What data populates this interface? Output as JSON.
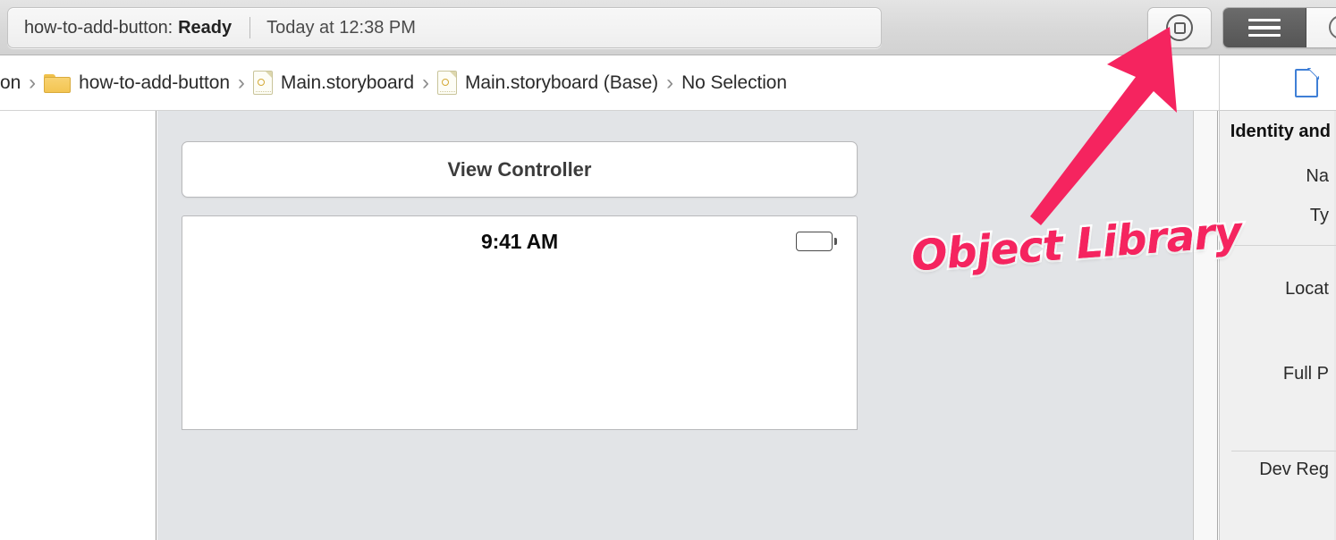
{
  "toolbar": {
    "status": {
      "project": "how-to-add-button:",
      "state": "Ready",
      "time": "Today at 12:38 PM"
    },
    "library_button_icon": "library-circle-square-icon",
    "editor_segments": [
      {
        "name": "standard-editor",
        "icon": "standard-editor-lines-icon",
        "selected": true
      },
      {
        "name": "assistant-editor",
        "icon": "assistant-editor-circles-icon",
        "selected": false
      }
    ]
  },
  "jumpbar": {
    "crumbs": [
      {
        "label": "on",
        "icon": ""
      },
      {
        "label": "how-to-add-button",
        "icon": "folder-icon"
      },
      {
        "label": "Main.storyboard",
        "icon": "storyboard-file-icon"
      },
      {
        "label": "Main.storyboard (Base)",
        "icon": "storyboard-file-icon"
      },
      {
        "label": "No Selection",
        "icon": ""
      }
    ],
    "separator": "›"
  },
  "canvas": {
    "scene_title": "View Controller",
    "device": {
      "status_time": "9:41 AM",
      "battery_icon": "battery-full-icon"
    },
    "background_color": "#e2e4e7"
  },
  "inspector": {
    "tab_icon": "file-inspector-icon",
    "header": "Identity and",
    "labels": [
      "Na",
      "Ty",
      "Locat",
      "Full P",
      "Dev Reg"
    ]
  },
  "annotation": {
    "text": "Object Library",
    "color": "#f5245f",
    "arrow": "arrow-pointing-up-right"
  }
}
